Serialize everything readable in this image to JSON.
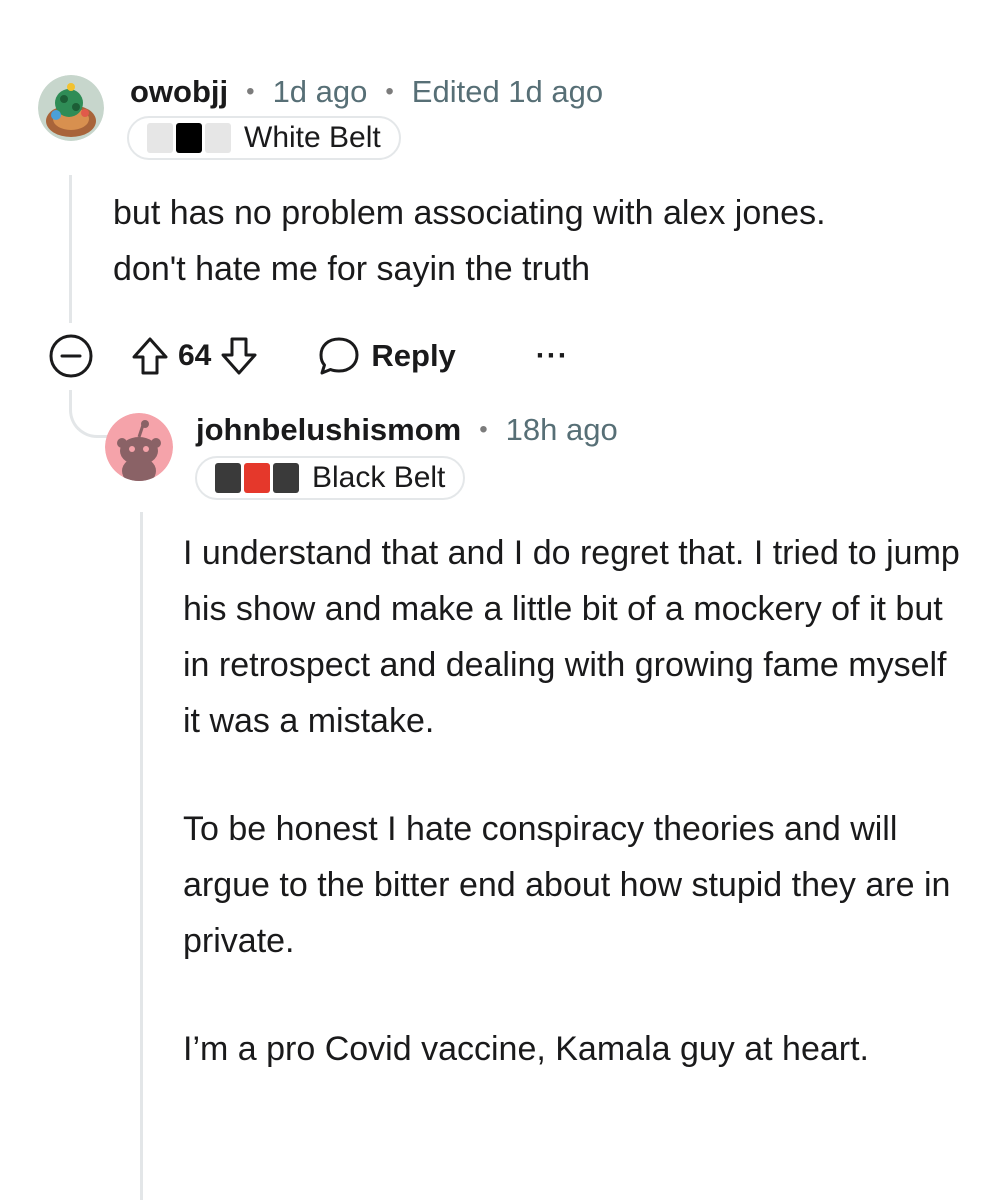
{
  "comments": [
    {
      "username": "owobjj",
      "time": "1d ago",
      "edited": "Edited 1d ago",
      "flair": {
        "text": "White Belt",
        "squares": [
          "#e6e6e6",
          "#000000",
          "#e6e6e6"
        ]
      },
      "body": [
        "but has no problem associating with alex jones. don't hate me for sayin the truth"
      ],
      "votes": "64",
      "reply_label": "Reply",
      "more_label": "···"
    },
    {
      "username": "johnbelushismom",
      "time": "18h ago",
      "flair": {
        "text": "Black Belt",
        "squares": [
          "#3a3a3a",
          "#e5382b",
          "#3a3a3a"
        ]
      },
      "body": [
        "I understand that and I do regret that. I tried to jump his show and make a little bit of a mockery of it but in retrospect and dealing with growing fame myself it was a mistake.",
        "To be honest I hate conspiracy theories and will argue to the bitter end about how stupid they are in private.",
        "I’m a pro Covid vaccine, Kamala guy at heart."
      ]
    }
  ],
  "separator": "•",
  "colors": {
    "thread_line": "#e3e6e8",
    "meta_gray": "#576f76",
    "avatar2_bg": "#f5a3aa"
  }
}
